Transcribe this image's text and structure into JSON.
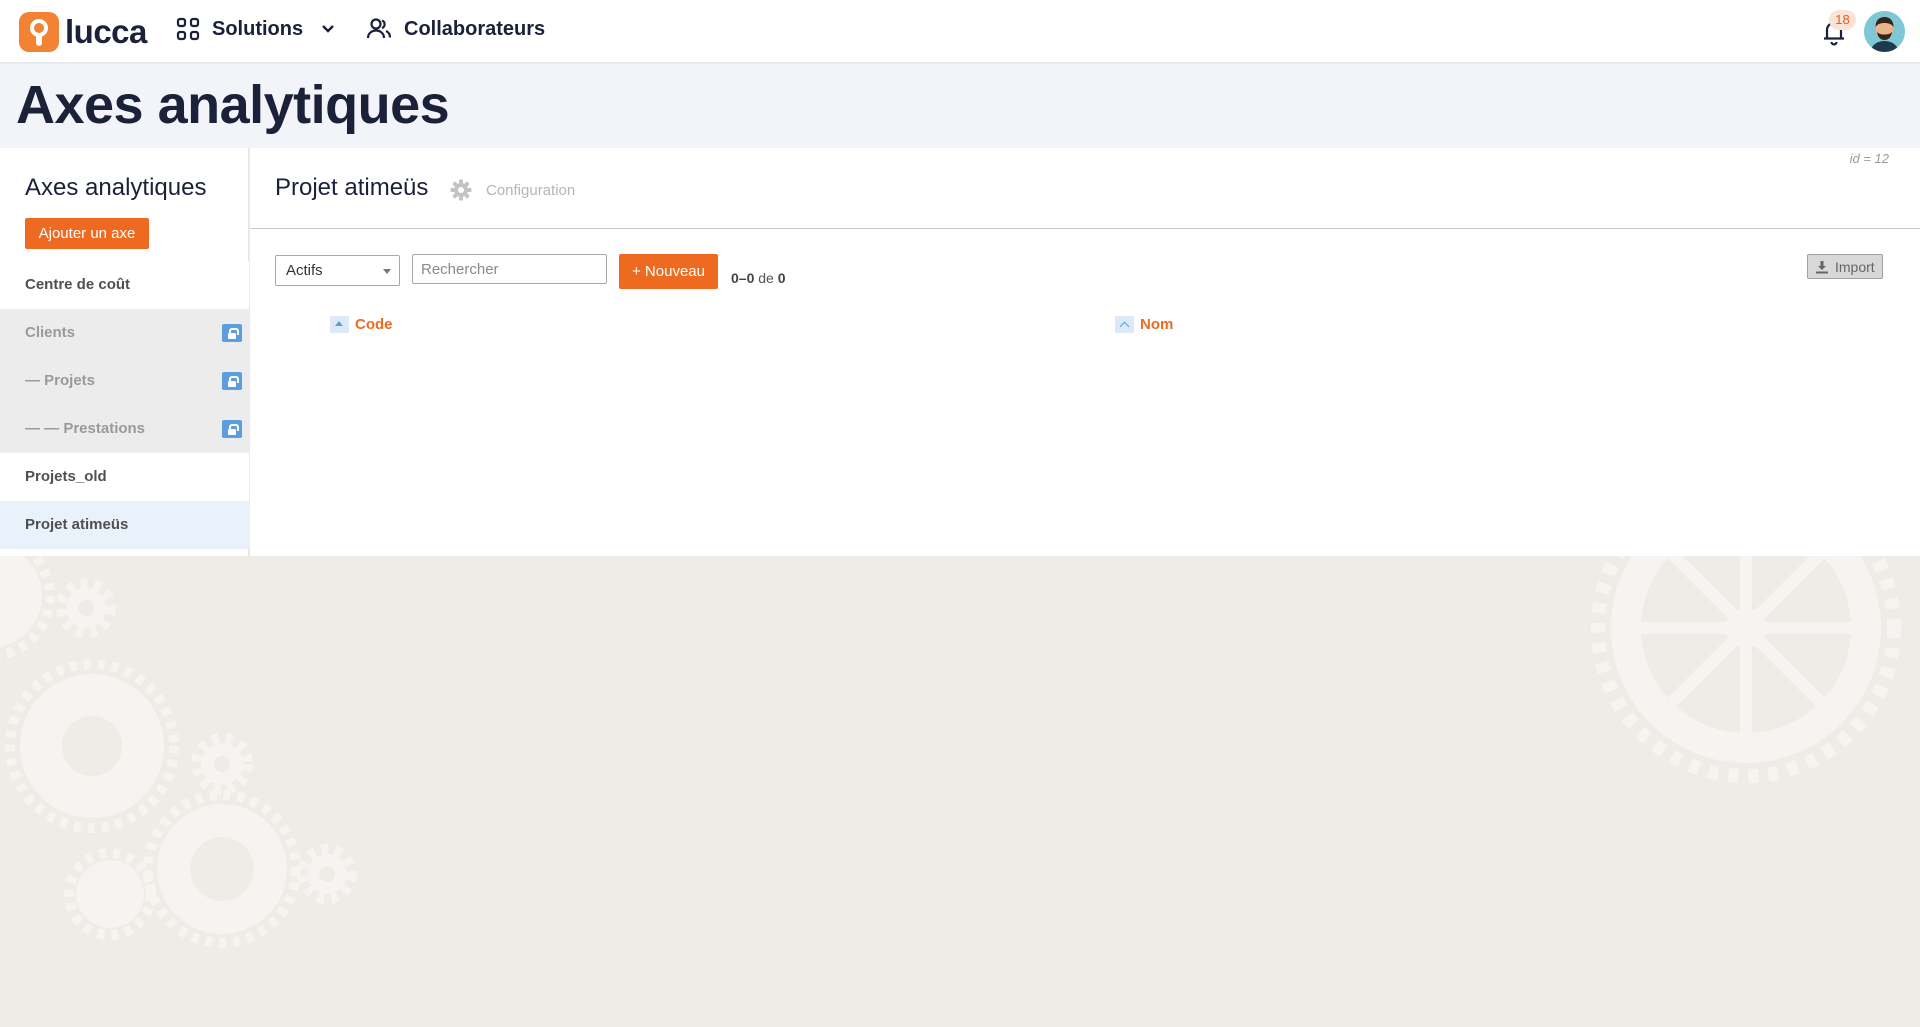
{
  "topbar": {
    "logo_text": "lucca",
    "nav": {
      "solutions_label": "Solutions",
      "collaborators_label": "Collaborateurs"
    },
    "notifications_count": "18"
  },
  "page": {
    "title": "Axes analytiques"
  },
  "sidebar": {
    "title": "Axes analytiques",
    "add_axis_label": "Ajouter un axe",
    "items": [
      {
        "label": "Centre de coût",
        "state": "normal"
      },
      {
        "label": "Clients",
        "state": "locked"
      },
      {
        "label": "— Projets",
        "state": "locked"
      },
      {
        "label": "— — Prestations",
        "state": "locked"
      },
      {
        "label": "Projets_old",
        "state": "normal"
      },
      {
        "label": "Projet atimeüs",
        "state": "active"
      }
    ]
  },
  "main": {
    "id_label": "id = 12",
    "title": "Projet atimeüs",
    "config_label": "Configuration",
    "filter": {
      "selected": "Actifs"
    },
    "search": {
      "placeholder": "Rechercher"
    },
    "new_label": "+ Nouveau",
    "count": {
      "range": "0–0",
      "of": "de",
      "total": "0"
    },
    "import_label": "Import",
    "columns": {
      "code": "Code",
      "nom": "Nom"
    }
  },
  "colors": {
    "accent": "#ef6a21",
    "brand": "#f28234",
    "lock": "#5b9de1"
  }
}
